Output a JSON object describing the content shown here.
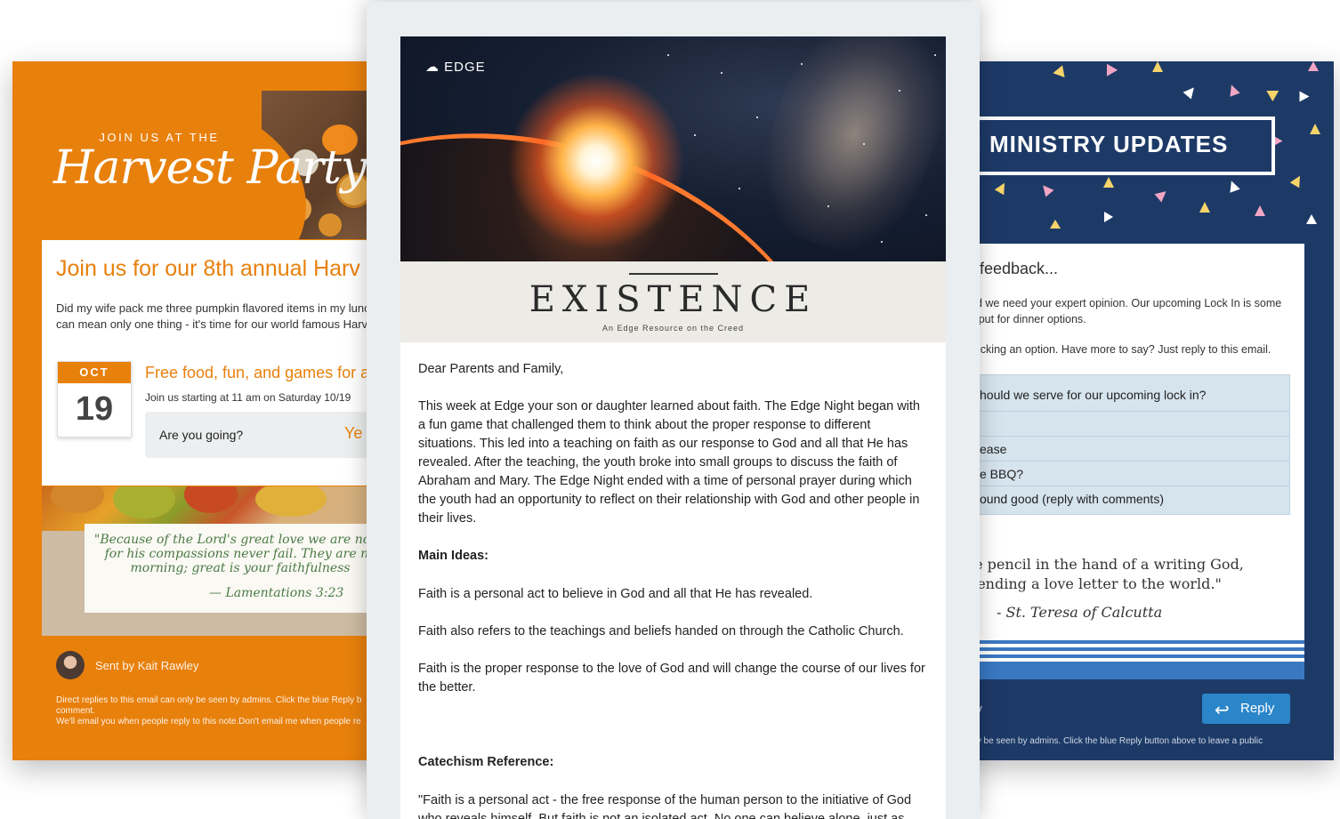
{
  "left_email": {
    "join_small": "JOIN US AT THE",
    "harvest_title": "Harvest Party",
    "heading": "Join us for our 8th annual Harv",
    "paragraph": "Did my wife pack me three pumpkin flavored items in my lunch can mean only one thing - it's time for our world famous Harves",
    "event": {
      "month": "OCT",
      "day": "19",
      "title": "Free food, fun, and games for a",
      "time": "Join us starting at 11 am on Saturday 10/19",
      "rsvp_label": "Are you going?",
      "rsvp_option": "Ye"
    },
    "quote": "\"Because of the Lord's great love we are not c for his compassions never fail. They are ne morning; great is your faithfulness",
    "quote_ref": "— Lamentations 3:23",
    "sent_by": "Sent by Kait Rawley",
    "fine_print": "Direct replies to this email can only be seen by admins. Click the blue Reply b comment.\nWe'll email you when people reply to this note.Don't email me when people re"
  },
  "right_email": {
    "banner": "H MINISTRY UPDATES",
    "heading": "r feedback...",
    "paragraph1": "nd we need your expert opinion. Our upcoming Lock In is some input for dinner options.",
    "paragraph2": "clicking an option. Have more to say? Just reply to this email.",
    "poll": {
      "question": "hould we serve for our upcoming lock in?",
      "options": [
        "",
        "ease",
        "e BBQ?",
        "ound good (reply with comments)"
      ]
    },
    "quote": "le pencil in the hand of a writing God, sending a love letter to the world.\"",
    "quote_ref": "- St. Teresa of Calcutta",
    "sent_by": "ey",
    "reply_label": "Reply",
    "fine_print": "nly be seen by admins. Click the blue Reply button above to leave a public"
  },
  "center_email": {
    "logo": "EDGE",
    "title": "EXISTENCE",
    "subtitle": "An Edge Resource on the Creed",
    "greeting": "Dear Parents and Family,",
    "paragraph1": "This week at Edge your son or daughter learned about faith. The Edge Night began with a fun game that challenged them to think about the proper response to different situations. This led into a teaching on faith as our response to God and all that He has revealed. After the teaching, the youth broke into small groups to discuss the faith of Abraham and Mary. The Edge Night ended with a time of personal prayer during which the youth had an opportunity to reflect on their relationship with God and other people in their lives.",
    "main_ideas_heading": "Main Ideas:",
    "idea1": "Faith is a personal act to believe in God and all that He has revealed.",
    "idea2": "Faith also refers to the teachings and beliefs handed on through the Catholic Church.",
    "idea3": "Faith is the proper response to the love of God and will change the course of our lives for the better.",
    "catechism_heading": "Catechism Reference:",
    "catechism_text": "\"Faith is a personal act - the free response of the human person to the initiative of God who reveals himself. But faith is not an isolated act. No one can believe alone, just as"
  },
  "colors": {
    "orange": "#e8800c",
    "navy": "#1d3a67",
    "reply_blue": "#2b86c9",
    "poll_bg": "#d6e4ee"
  }
}
